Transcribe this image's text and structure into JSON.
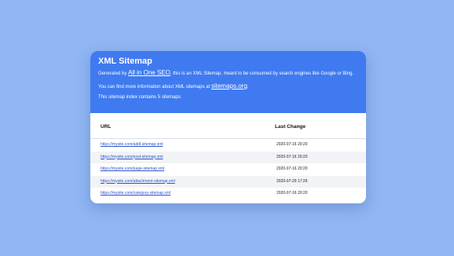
{
  "header": {
    "title": "XML Sitemap",
    "generated_prefix": "Generated by ",
    "generator_link": "All in One SEO",
    "generated_suffix": ", this is an XML Sitemap, meant to be consumed by search engines like Google or Bing.",
    "info_prefix": "You can find more information about XML sitemaps at ",
    "info_link": "sitemaps.org",
    "info_suffix": ".",
    "count_text": "This sitemap index contains 5 sitemaps."
  },
  "table": {
    "columns": [
      "URL",
      "Last Change"
    ],
    "rows": [
      {
        "url": "https://mysite.com/addl-sitemap.xml",
        "last_change": "2020-07-16 20:20"
      },
      {
        "url": "https://mysite.com/post-sitemap.xml",
        "last_change": "2020-07-16 20:20"
      },
      {
        "url": "https://mysite.com/page-sitemap.xml",
        "last_change": "2020-07-16 20:20"
      },
      {
        "url": "https://mysite.com/attachment-sitemap.xml",
        "last_change": "2020-07-29 17:26"
      },
      {
        "url": "https://mysite.com/category-sitemap.xml",
        "last_change": "2020-07-16 20:20"
      }
    ]
  },
  "colors": {
    "background": "#90b6f3",
    "header": "#3f7af0",
    "link": "#2c55c9"
  }
}
